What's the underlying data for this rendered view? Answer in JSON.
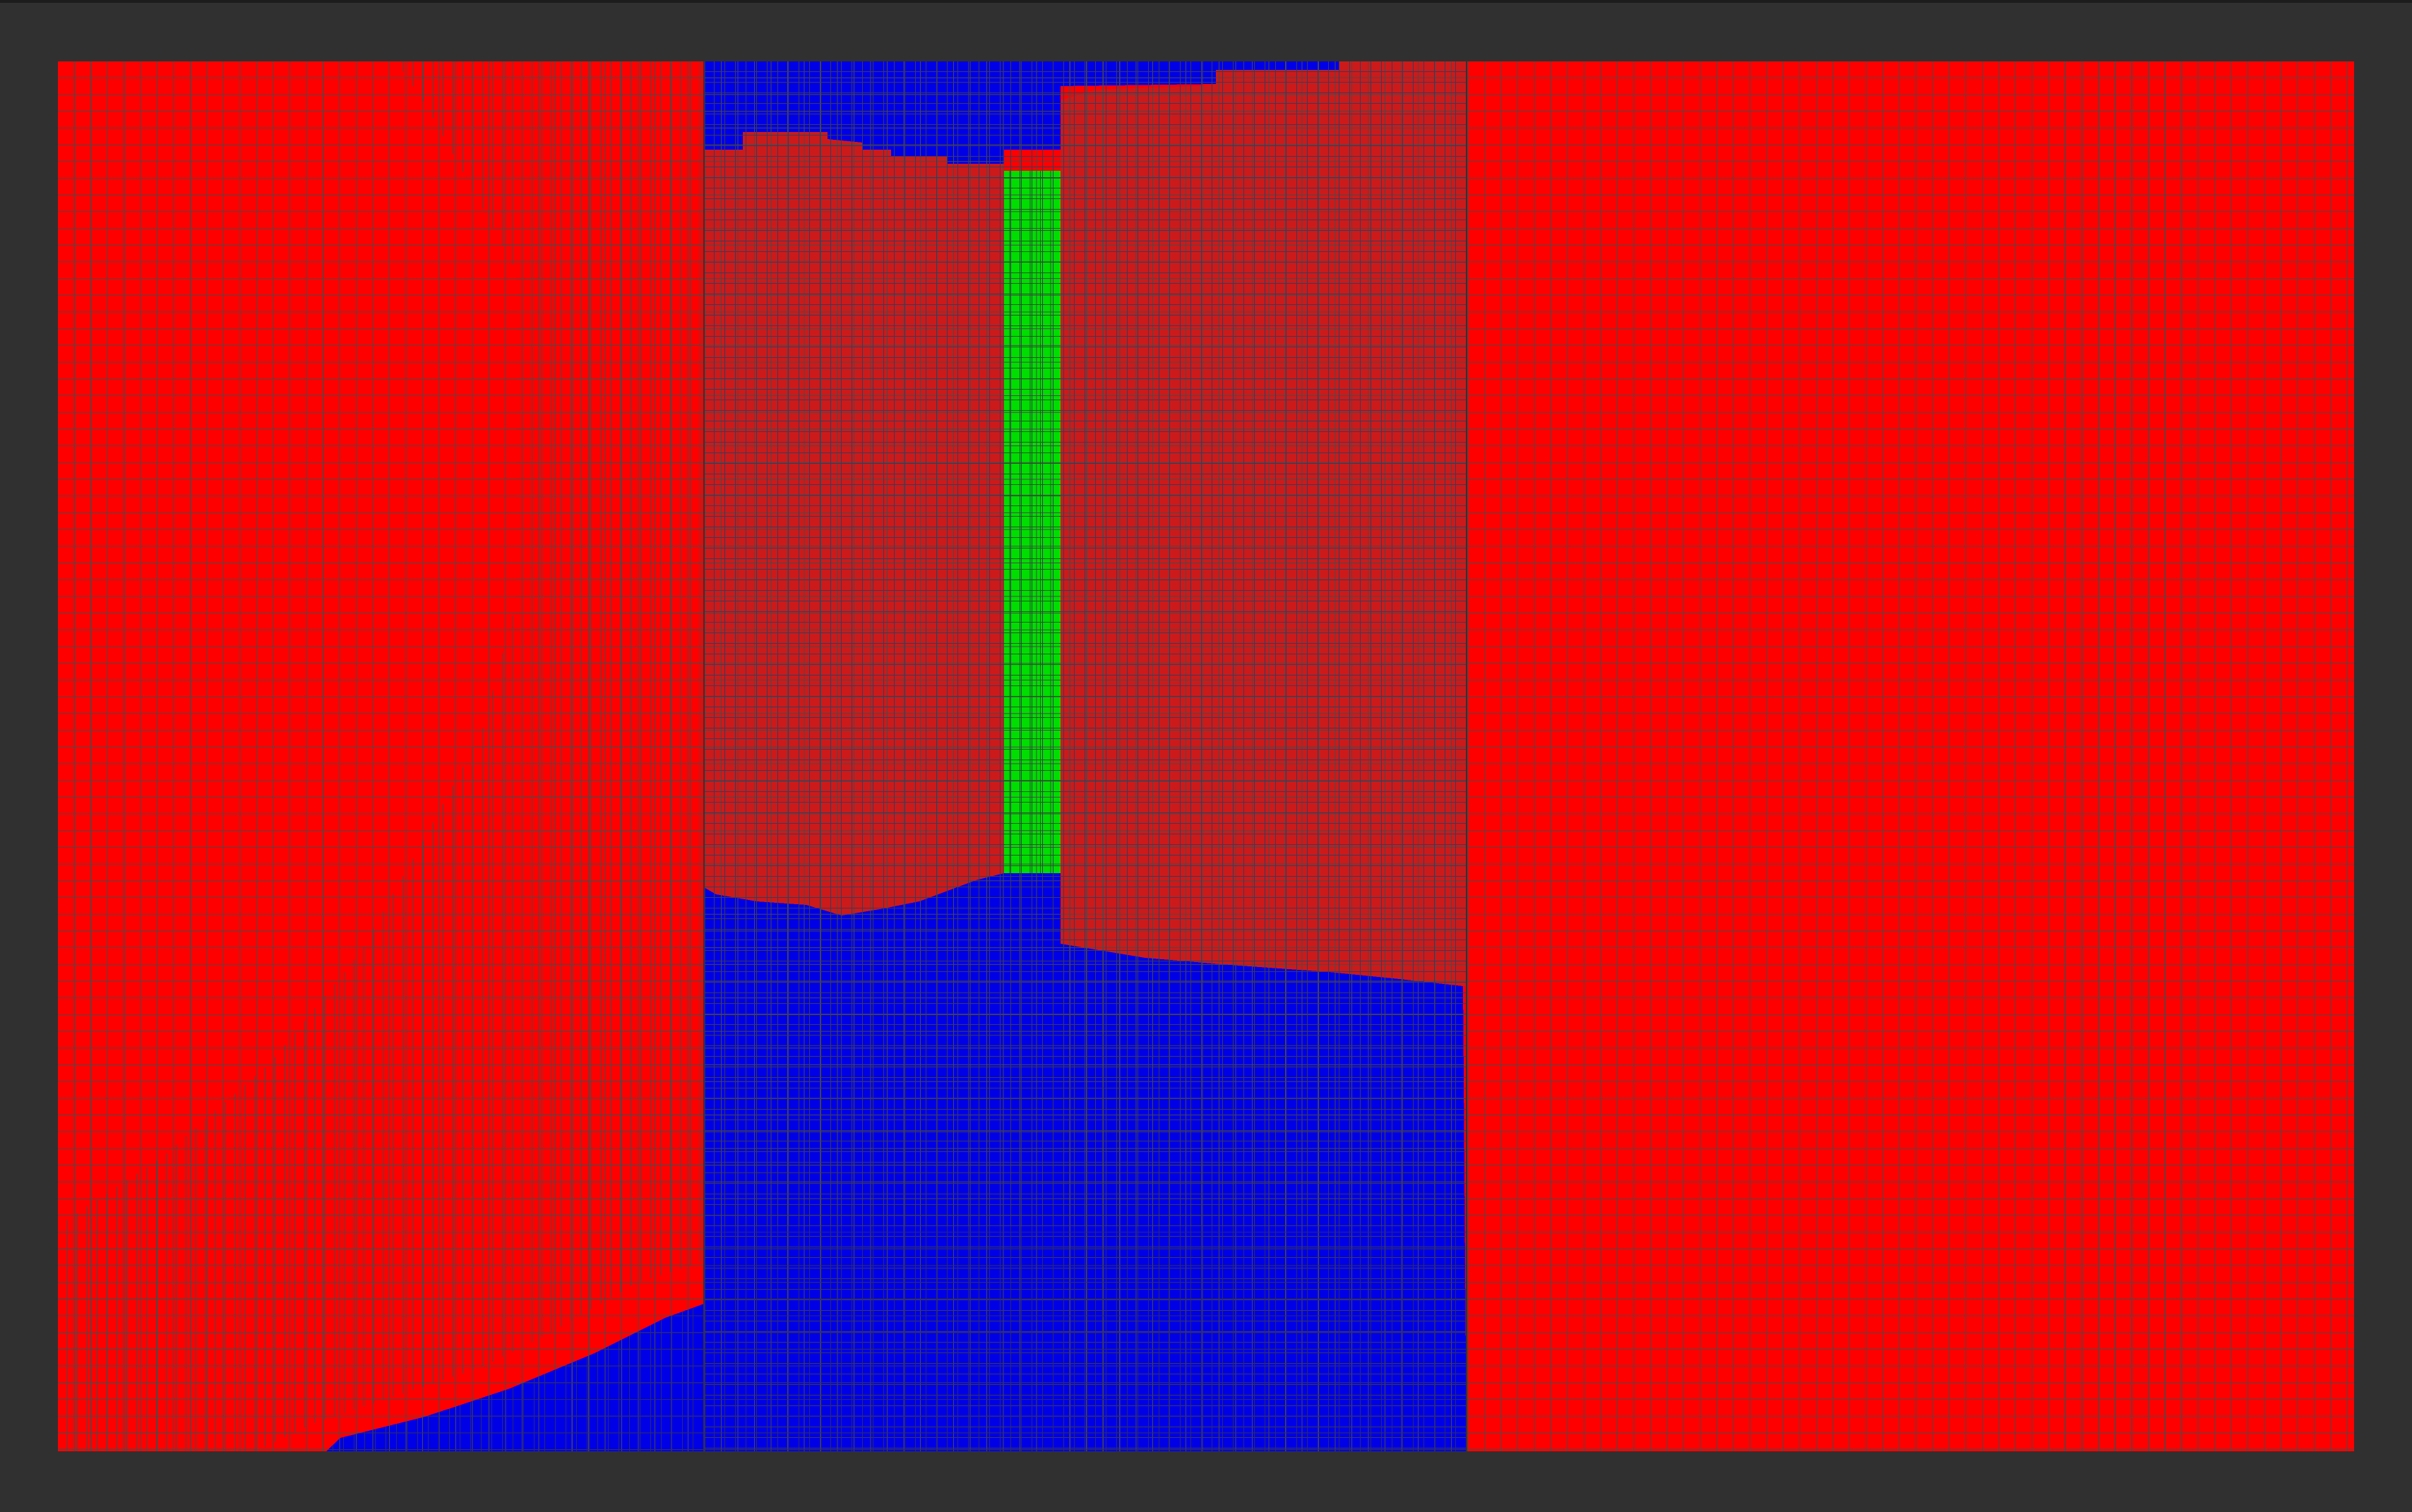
{
  "canvas": {
    "background_color": "#303030"
  },
  "mesh": {
    "grid_line_color": "#4a4a4a",
    "materials": [
      {
        "id": "outer-material",
        "color": "#ff0000"
      },
      {
        "id": "inner-material",
        "color": "#cc1a1a"
      },
      {
        "id": "fill-material",
        "color": "#0000e6"
      },
      {
        "id": "core-material",
        "color": "#00dd00"
      }
    ]
  }
}
